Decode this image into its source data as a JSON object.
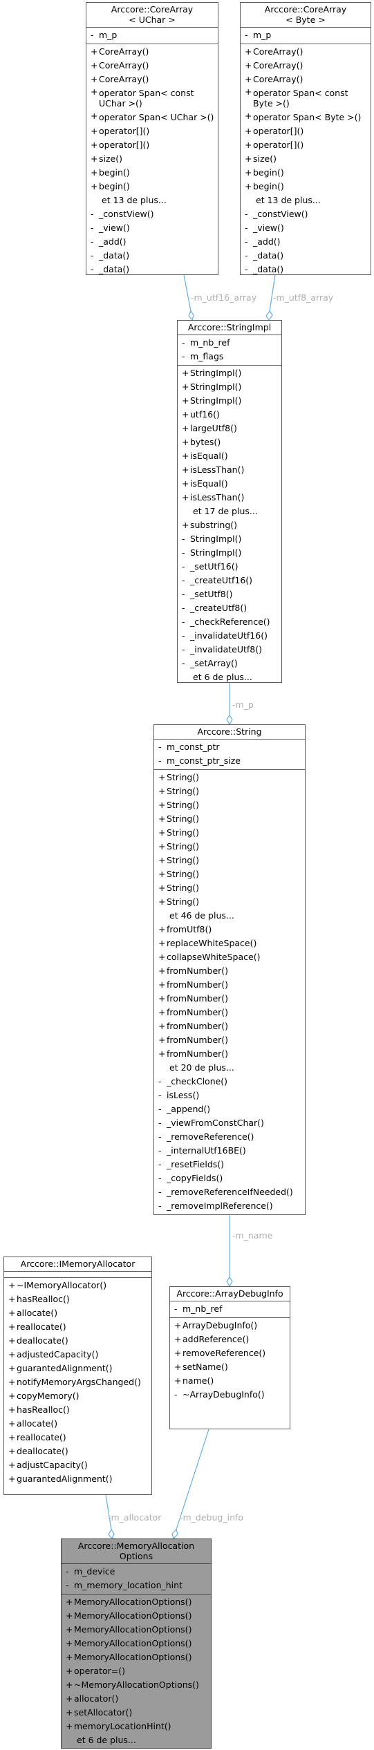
{
  "colors": {
    "edge": "#63b0e8",
    "label": "#b0b0b0",
    "focus_bg": "#9b9b9b"
  },
  "classes": {
    "core_array_uchar": {
      "title": "Arccore::CoreArray\n< UChar >",
      "attributes": [
        {
          "vis": "-",
          "name": "m_p"
        }
      ],
      "methods": [
        {
          "vis": "+",
          "name": "CoreArray()"
        },
        {
          "vis": "+",
          "name": "CoreArray()"
        },
        {
          "vis": "+",
          "name": "CoreArray()"
        },
        {
          "vis": "+",
          "name": "operator Span< const UChar >()"
        },
        {
          "vis": "+",
          "name": "operator Span< UChar >()"
        },
        {
          "vis": "+",
          "name": "operator[]()"
        },
        {
          "vis": "+",
          "name": "operator[]()"
        },
        {
          "vis": "+",
          "name": "size()"
        },
        {
          "vis": "+",
          "name": "begin()"
        },
        {
          "vis": "+",
          "name": "begin()"
        },
        {
          "vis": "",
          "name": "et 13 de plus..."
        },
        {
          "vis": "-",
          "name": "_constView()"
        },
        {
          "vis": "-",
          "name": "_view()"
        },
        {
          "vis": "-",
          "name": "_add()"
        },
        {
          "vis": "-",
          "name": "_data()"
        },
        {
          "vis": "-",
          "name": "_data()"
        }
      ]
    },
    "core_array_byte": {
      "title": "Arccore::CoreArray\n< Byte >",
      "attributes": [
        {
          "vis": "-",
          "name": "m_p"
        }
      ],
      "methods": [
        {
          "vis": "+",
          "name": "CoreArray()"
        },
        {
          "vis": "+",
          "name": "CoreArray()"
        },
        {
          "vis": "+",
          "name": "CoreArray()"
        },
        {
          "vis": "+",
          "name": "operator Span< const Byte >()"
        },
        {
          "vis": "+",
          "name": "operator Span< Byte >()"
        },
        {
          "vis": "+",
          "name": "operator[]()"
        },
        {
          "vis": "+",
          "name": "operator[]()"
        },
        {
          "vis": "+",
          "name": "size()"
        },
        {
          "vis": "+",
          "name": "begin()"
        },
        {
          "vis": "+",
          "name": "begin()"
        },
        {
          "vis": "",
          "name": "et 13 de plus..."
        },
        {
          "vis": "-",
          "name": "_constView()"
        },
        {
          "vis": "-",
          "name": "_view()"
        },
        {
          "vis": "-",
          "name": "_add()"
        },
        {
          "vis": "-",
          "name": "_data()"
        },
        {
          "vis": "-",
          "name": "_data()"
        }
      ]
    },
    "string_impl": {
      "title": "Arccore::StringImpl",
      "attributes": [
        {
          "vis": "-",
          "name": "m_nb_ref"
        },
        {
          "vis": "-",
          "name": "m_flags"
        }
      ],
      "methods": [
        {
          "vis": "+",
          "name": "StringImpl()"
        },
        {
          "vis": "+",
          "name": "StringImpl()"
        },
        {
          "vis": "+",
          "name": "StringImpl()"
        },
        {
          "vis": "+",
          "name": "utf16()"
        },
        {
          "vis": "+",
          "name": "largeUtf8()"
        },
        {
          "vis": "+",
          "name": "bytes()"
        },
        {
          "vis": "+",
          "name": "isEqual()"
        },
        {
          "vis": "+",
          "name": "isLessThan()"
        },
        {
          "vis": "+",
          "name": "isEqual()"
        },
        {
          "vis": "+",
          "name": "isLessThan()"
        },
        {
          "vis": "",
          "name": "et 17 de plus..."
        },
        {
          "vis": "+",
          "name": "substring()"
        },
        {
          "vis": "-",
          "name": "StringImpl()"
        },
        {
          "vis": "-",
          "name": "StringImpl()"
        },
        {
          "vis": "-",
          "name": "_setUtf16()"
        },
        {
          "vis": "-",
          "name": "_createUtf16()"
        },
        {
          "vis": "-",
          "name": "_setUtf8()"
        },
        {
          "vis": "-",
          "name": "_createUtf8()"
        },
        {
          "vis": "-",
          "name": "_checkReference()"
        },
        {
          "vis": "-",
          "name": "_invalidateUtf16()"
        },
        {
          "vis": "-",
          "name": "_invalidateUtf8()"
        },
        {
          "vis": "-",
          "name": "_setArray()"
        },
        {
          "vis": "",
          "name": "et 6 de plus..."
        }
      ]
    },
    "string": {
      "title": "Arccore::String",
      "attributes": [
        {
          "vis": "-",
          "name": "m_const_ptr"
        },
        {
          "vis": "-",
          "name": "m_const_ptr_size"
        }
      ],
      "methods": [
        {
          "vis": "+",
          "name": "String()"
        },
        {
          "vis": "+",
          "name": "String()"
        },
        {
          "vis": "+",
          "name": "String()"
        },
        {
          "vis": "+",
          "name": "String()"
        },
        {
          "vis": "+",
          "name": "String()"
        },
        {
          "vis": "+",
          "name": "String()"
        },
        {
          "vis": "+",
          "name": "String()"
        },
        {
          "vis": "+",
          "name": "String()"
        },
        {
          "vis": "+",
          "name": "String()"
        },
        {
          "vis": "+",
          "name": "String()"
        },
        {
          "vis": "",
          "name": "et 46 de plus..."
        },
        {
          "vis": "+",
          "name": "fromUtf8()"
        },
        {
          "vis": "+",
          "name": "replaceWhiteSpace()"
        },
        {
          "vis": "+",
          "name": "collapseWhiteSpace()"
        },
        {
          "vis": "+",
          "name": "fromNumber()"
        },
        {
          "vis": "+",
          "name": "fromNumber()"
        },
        {
          "vis": "+",
          "name": "fromNumber()"
        },
        {
          "vis": "+",
          "name": "fromNumber()"
        },
        {
          "vis": "+",
          "name": "fromNumber()"
        },
        {
          "vis": "+",
          "name": "fromNumber()"
        },
        {
          "vis": "+",
          "name": "fromNumber()"
        },
        {
          "vis": "",
          "name": "et 20 de plus..."
        },
        {
          "vis": "-",
          "name": "_checkClone()"
        },
        {
          "vis": "-",
          "name": "isLess()"
        },
        {
          "vis": "-",
          "name": "_append()"
        },
        {
          "vis": "-",
          "name": "_viewFromConstChar()"
        },
        {
          "vis": "-",
          "name": "_removeReference()"
        },
        {
          "vis": "-",
          "name": "_internalUtf16BE()"
        },
        {
          "vis": "-",
          "name": "_resetFields()"
        },
        {
          "vis": "-",
          "name": "_copyFields()"
        },
        {
          "vis": "-",
          "name": "_removeReferenceIfNeeded()"
        },
        {
          "vis": "-",
          "name": "_removeImplReference()"
        }
      ]
    },
    "imemory_allocator": {
      "title": "Arccore::IMemoryAllocator",
      "attributes": [],
      "methods": [
        {
          "vis": "+",
          "name": "~IMemoryAllocator()"
        },
        {
          "vis": "+",
          "name": "hasRealloc()"
        },
        {
          "vis": "+",
          "name": "allocate()"
        },
        {
          "vis": "+",
          "name": "reallocate()"
        },
        {
          "vis": "+",
          "name": "deallocate()"
        },
        {
          "vis": "+",
          "name": "adjustedCapacity()"
        },
        {
          "vis": "+",
          "name": "guarantedAlignment()"
        },
        {
          "vis": "+",
          "name": "notifyMemoryArgsChanged()"
        },
        {
          "vis": "+",
          "name": "copyMemory()"
        },
        {
          "vis": "+",
          "name": "hasRealloc()"
        },
        {
          "vis": "+",
          "name": "allocate()"
        },
        {
          "vis": "+",
          "name": "reallocate()"
        },
        {
          "vis": "+",
          "name": "deallocate()"
        },
        {
          "vis": "+",
          "name": "adjustCapacity()"
        },
        {
          "vis": "+",
          "name": "guarantedAlignment()"
        }
      ]
    },
    "array_debug_info": {
      "title": "Arccore::ArrayDebugInfo",
      "attributes": [
        {
          "vis": "-",
          "name": "m_nb_ref"
        }
      ],
      "methods": [
        {
          "vis": "+",
          "name": "ArrayDebugInfo()"
        },
        {
          "vis": "+",
          "name": "addReference()"
        },
        {
          "vis": "+",
          "name": "removeReference()"
        },
        {
          "vis": "+",
          "name": "setName()"
        },
        {
          "vis": "+",
          "name": "name()"
        },
        {
          "vis": "-",
          "name": "~ArrayDebugInfo()"
        }
      ]
    },
    "memory_allocation_options": {
      "title": "Arccore::MemoryAllocation\nOptions",
      "attributes": [
        {
          "vis": "-",
          "name": "m_device"
        },
        {
          "vis": "-",
          "name": "m_memory_location_hint"
        }
      ],
      "methods": [
        {
          "vis": "+",
          "name": "MemoryAllocationOptions()"
        },
        {
          "vis": "+",
          "name": "MemoryAllocationOptions()"
        },
        {
          "vis": "+",
          "name": "MemoryAllocationOptions()"
        },
        {
          "vis": "+",
          "name": "MemoryAllocationOptions()"
        },
        {
          "vis": "+",
          "name": "MemoryAllocationOptions()"
        },
        {
          "vis": "+",
          "name": "operator=()"
        },
        {
          "vis": "+",
          "name": "~MemoryAllocationOptions()"
        },
        {
          "vis": "+",
          "name": "allocator()"
        },
        {
          "vis": "+",
          "name": "setAllocator()"
        },
        {
          "vis": "+",
          "name": "memoryLocationHint()"
        },
        {
          "vis": "",
          "name": "et 6 de plus..."
        }
      ]
    }
  },
  "edges": {
    "m_utf16_array": "-m_utf16_array",
    "m_utf8_array": "-m_utf8_array",
    "m_p": "-m_p",
    "m_name": "-m_name",
    "m_allocator": "-m_allocator",
    "m_debug_info": "-m_debug_info"
  }
}
